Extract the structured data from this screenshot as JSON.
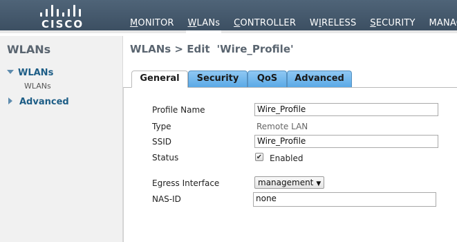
{
  "brand": {
    "logo_text": "CISCO"
  },
  "nav": [
    {
      "label": "MONITOR",
      "u": "M",
      "rest": "ONITOR",
      "active": false
    },
    {
      "label": "WLANs",
      "u": "W",
      "rest": "LANs",
      "active": true
    },
    {
      "label": "CONTROLLER",
      "u": "C",
      "rest": "ONTROLLER",
      "active": false
    },
    {
      "label": "WIRELESS",
      "u": "I",
      "pre": "W",
      "rest": "RELESS",
      "active": false
    },
    {
      "label": "SECURITY",
      "u": "S",
      "rest": "ECURITY",
      "active": false
    },
    {
      "label": "MANAGEMENT",
      "u": "",
      "rest": "MANAGEM",
      "active": false
    }
  ],
  "sidebar": {
    "heading": "WLANs",
    "section1": "WLANs",
    "section1_sub": "WLANs",
    "section2": "Advanced"
  },
  "page": {
    "title": "WLANs > Edit",
    "title_quoted": "'Wire_Profile'"
  },
  "tabs": {
    "general": "General",
    "security": "Security",
    "qos": "QoS",
    "advanced": "Advanced"
  },
  "form": {
    "profile_name_label": "Profile Name",
    "profile_name_value": "Wire_Profile",
    "type_label": "Type",
    "type_value": "Remote LAN",
    "ssid_label": "SSID",
    "ssid_value": "Wire_Profile",
    "status_label": "Status",
    "status_checked": true,
    "status_text": "Enabled",
    "egress_label": "Egress Interface",
    "egress_value": "management",
    "nasid_label": "NAS-ID",
    "nasid_value": "none"
  }
}
